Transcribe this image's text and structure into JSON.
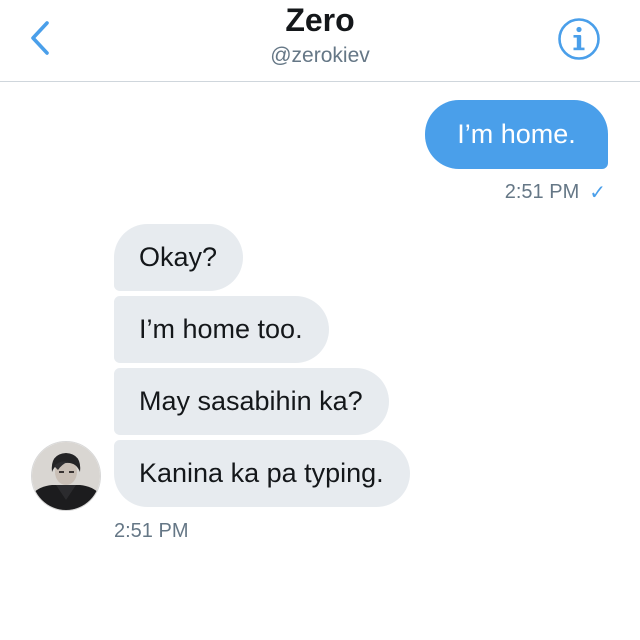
{
  "header": {
    "title": "Zero",
    "handle": "@zerokiev"
  },
  "conversation": {
    "outgoing": [
      {
        "text": "I’m home.",
        "time": "2:51 PM",
        "status": "✓"
      }
    ],
    "incoming": {
      "messages": [
        "Okay?",
        "I’m home too.",
        "May sasabihin ka?",
        "Kanina ka pa typing."
      ],
      "time": "2:51 PM"
    }
  },
  "icons": {
    "back": "chevron-left-icon",
    "info": "info-circle-icon",
    "read": "checkmark-icon"
  },
  "colors": {
    "accent": "#4a9fea",
    "incoming_bubble": "#e7ebef",
    "secondary_text": "#657786",
    "divider": "#cfd6dc"
  }
}
